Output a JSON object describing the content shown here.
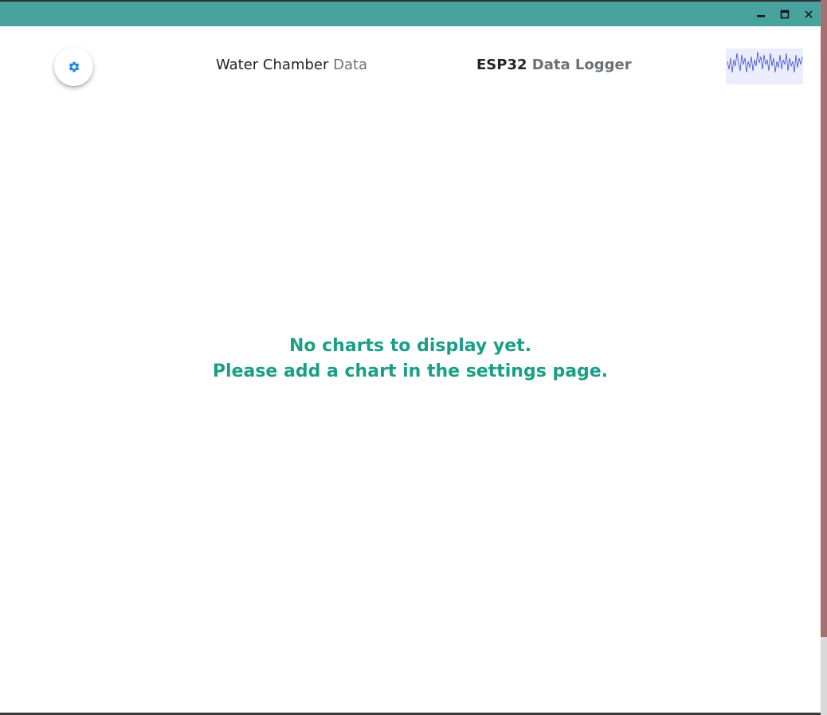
{
  "window": {
    "controls": [
      "minimize",
      "maximize",
      "close"
    ],
    "colors": {
      "titlebar": "#48a39e",
      "scroll_thumb": "#a57070"
    }
  },
  "header": {
    "settings_icon": "gear-icon",
    "settings_icon_color": "#1e88e5",
    "chamber_title": {
      "primary": "Water Chamber",
      "secondary": "Data"
    },
    "app_title": {
      "primary": "ESP32",
      "secondary": "Data Logger"
    },
    "logo": "sparkline-logo"
  },
  "main": {
    "empty_line1": "No charts to display yet.",
    "empty_line2": "Please add a chart in the settings page.",
    "message_color": "#1b9e86"
  }
}
